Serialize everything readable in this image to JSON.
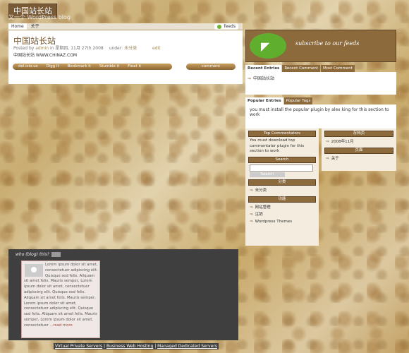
{
  "site": {
    "title": "中国站长站",
    "description": "又一个 WordPress blog"
  },
  "nav": {
    "tabs": [
      "Home",
      "关于"
    ],
    "feeds_label": "feeds"
  },
  "post": {
    "title": "中国站长站",
    "meta_posted_by": "Posted by",
    "meta_author": "admin",
    "meta_in": "in",
    "meta_date": "星期四, 11月 27th 2008",
    "meta_under": "under:",
    "meta_category": "未分类",
    "meta_edit": "edit",
    "body": "中国站长站  WWW.CHINAZ.COM",
    "actions": [
      "del.icio.us",
      "Digg it",
      "Bookmark it",
      "Stumble it",
      "Float it"
    ],
    "comment_label": "comment"
  },
  "subscribe": {
    "text": "subscribe to our feeds"
  },
  "tabbox1": {
    "tabs": [
      "Recent Entries",
      "Recent Comment",
      "Most Comment"
    ],
    "items": [
      "中国站长站"
    ]
  },
  "tabbox2": {
    "tabs": [
      "Popular Entries",
      "Popular Tags"
    ],
    "text": "you must install the popular plugin by alex king for this section to work"
  },
  "widgets": {
    "top_commentators": {
      "title": "Top Commentators",
      "text": "You must download top commentator plugin for this section to work"
    },
    "search": {
      "title": "Search",
      "button": "Search"
    },
    "categories": {
      "title": "分类",
      "items": [
        "未分类"
      ]
    },
    "meta": {
      "title": "功能",
      "items": [
        "网站管理",
        "注销",
        "Wordpress Themes"
      ]
    },
    "archives": {
      "title": "存档页",
      "items": [
        "2008年11月"
      ]
    },
    "pages": {
      "title": "页面",
      "items": [
        "关于"
      ]
    }
  },
  "about": {
    "title": "who (blog) this?",
    "text": "Lorem ipsum dolor sit amet, consectetuer adipiscing elit. Quisque sed felis. Aliquam sit amet felis. Mauris semper, Lorem ipsum dolor sit amet, consectetuer adipiscing elit. Quisque sed felis. Aliquam sit amet felis. Mauris semper, Lorem ipsum dolor sit amet, consectetuer adipiscing elit. Quisque sed felis. Aliquam sit amet felis. Mauris semper, Lorem ipsum dolor sit amet, consectetuer",
    "read_more": "...read more"
  },
  "footer": {
    "links": [
      "Virtual Private Servers",
      "Business Web Hosting",
      "Managed Dedicated Servers"
    ],
    "separator": " | "
  },
  "colors": {
    "brown": "#8c6a3c",
    "dark": "#3f3f3f",
    "rss_green": "#5fae2e"
  },
  "icons": {
    "rss": "rss-icon",
    "avatar": "avatar-icon"
  }
}
